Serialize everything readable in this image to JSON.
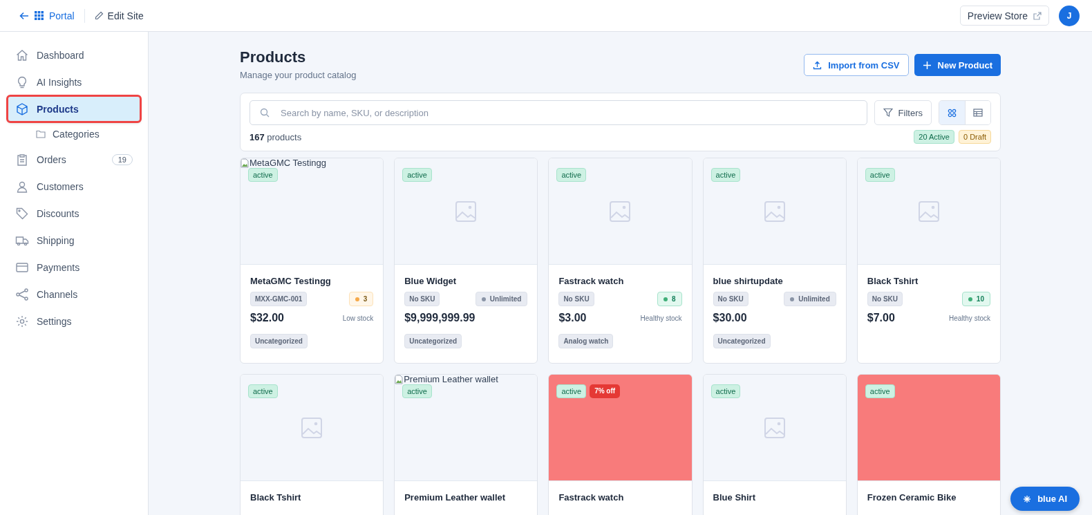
{
  "topbar": {
    "back_label": "Portal",
    "edit_label": "Edit Site",
    "preview_label": "Preview Store",
    "avatar": "J"
  },
  "sidebar": {
    "items": [
      {
        "label": "Dashboard",
        "selected": false
      },
      {
        "label": "AI Insights",
        "selected": false
      },
      {
        "label": "Products",
        "selected": true,
        "children": [
          {
            "label": "Categories",
            "selected": false
          }
        ]
      },
      {
        "label": "Orders",
        "selected": false,
        "badge": "19"
      },
      {
        "label": "Customers",
        "selected": false
      },
      {
        "label": "Discounts",
        "selected": false
      },
      {
        "label": "Shipping",
        "selected": false
      },
      {
        "label": "Payments",
        "selected": false
      },
      {
        "label": "Channels",
        "selected": false
      },
      {
        "label": "Settings",
        "selected": false
      }
    ]
  },
  "page": {
    "title": "Products",
    "subtitle": "Manage your product catalog",
    "import_label": "Import from CSV",
    "new_label": "New Product"
  },
  "toolbar": {
    "search_placeholder": "Search by name, SKU, or description",
    "filters_label": "Filters",
    "views": [
      {
        "selected": true
      },
      {
        "selected": false
      }
    ],
    "count": "167",
    "count_label": "products",
    "active_count": "20 Active",
    "draft_count": "0 Draft"
  },
  "products": [
    {
      "image": {
        "kind": "broken",
        "alt": "MetaGMC Testingg"
      },
      "status": "active",
      "name": "MetaGMC Testingg",
      "sku": "MXX-GMC-001",
      "stock": {
        "kind": "low",
        "value": "3"
      },
      "price": "$32.00",
      "stock_note": "Low stock",
      "category": "Uncategorized"
    },
    {
      "image": {
        "kind": "placeholder"
      },
      "status": "active",
      "name": "Blue Widget",
      "sku": "No SKU",
      "stock": {
        "kind": "unlimited",
        "value": "Unlimited"
      },
      "price": "$9,999,999.99",
      "category": "Uncategorized"
    },
    {
      "image": {
        "kind": "placeholder"
      },
      "status": "active",
      "name": "Fastrack watch",
      "sku": "No SKU",
      "stock": {
        "kind": "healthy",
        "value": "8"
      },
      "price": "$3.00",
      "stock_note": "Healthy stock",
      "category": "Analog watch"
    },
    {
      "image": {
        "kind": "placeholder"
      },
      "status": "active",
      "name": "blue shirtupdate",
      "sku": "No SKU",
      "stock": {
        "kind": "unlimited",
        "value": "Unlimited"
      },
      "price": "$30.00",
      "category": "Uncategorized"
    },
    {
      "image": {
        "kind": "placeholder"
      },
      "status": "active",
      "name": "Black Tshirt",
      "sku": "No SKU",
      "stock": {
        "kind": "healthy",
        "value": "10"
      },
      "price": "$7.00",
      "stock_note": "Healthy stock"
    },
    {
      "image": {
        "kind": "placeholder"
      },
      "status": "active",
      "name": "Black Tshirt"
    },
    {
      "image": {
        "kind": "broken",
        "alt": "Premium Leather wallet"
      },
      "status": "active",
      "name": "Premium Leather wallet"
    },
    {
      "image": {
        "kind": "color",
        "color": "#f87b7b"
      },
      "status": "active",
      "discount": "7% off",
      "name": "Fastrack watch"
    },
    {
      "image": {
        "kind": "placeholder"
      },
      "status": "active",
      "name": "Blue Shirt"
    },
    {
      "image": {
        "kind": "color",
        "color": "#f87b7b"
      },
      "status": "active",
      "name": "Frozen Ceramic Bike"
    }
  ],
  "assistant": {
    "label": "blue AI"
  }
}
